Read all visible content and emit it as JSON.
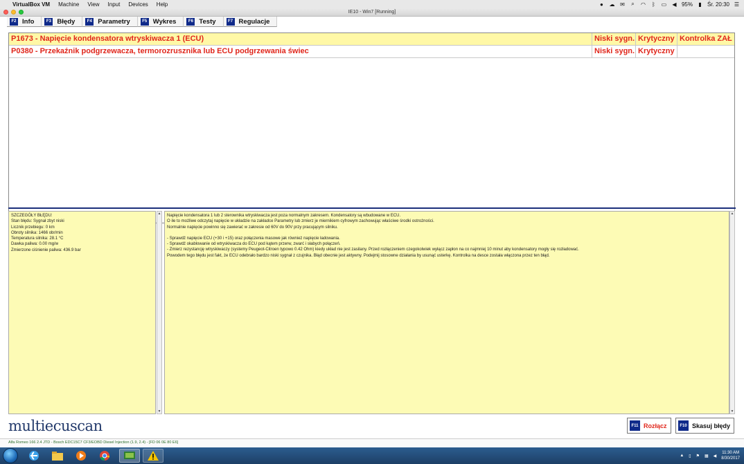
{
  "mac_menubar": {
    "app": "VirtualBox VM",
    "menus": [
      "Machine",
      "View",
      "Input",
      "Devices",
      "Help"
    ],
    "battery": "95%",
    "clock": "Śr. 20:30"
  },
  "window": {
    "title": "IE10 - Win7 [Running]"
  },
  "tabs": [
    {
      "key": "F2",
      "label": "Info"
    },
    {
      "key": "F3",
      "label": "Błędy"
    },
    {
      "key": "F4",
      "label": "Parametry"
    },
    {
      "key": "F5",
      "label": "Wykres"
    },
    {
      "key": "F6",
      "label": "Testy"
    },
    {
      "key": "F7",
      "label": "Regulacje"
    }
  ],
  "errors": [
    {
      "code_desc": "P1673 - Napięcie kondensatora wtryskiwacza 1 (ECU)",
      "signal": "Niski sygn.",
      "severity": "Krytyczny",
      "lamp": "Kontrolka ZAŁ"
    },
    {
      "code_desc": "P0380 - Przekaźnik podgrzewacza, termorozrusznika lub ECU podgrzewania świec",
      "signal": "Niski sygn.",
      "severity": "Krytyczny",
      "lamp": ""
    }
  ],
  "details": {
    "header": "SZCZEGÓŁY BŁĘDU:",
    "lines": [
      "Stan błędu: Sygnał zbyt niski",
      "Licznik przebiegu: 0 km",
      "Obroty silnika: 1466 obr/min",
      "Temperatura silnika: 28.1 °C",
      "Dawka paliwa: 0.00 mg/w",
      "Zmierzone ciśnienie paliwa: 436.9 bar"
    ]
  },
  "description": {
    "lines": [
      "Napięcie kondensatora 1 lub 2 sterownika wtryskiwacza jest poza normalnym zakresem. Kondensatory są wbudowane w ECU.",
      "O ile to możliwe odczytaj napięcie w układzie na zakładce Parametry lub zmierz je miernikiem cyfrowym zachowując właściwe środki ostrożności.",
      "Normalnie napięcie powinno się zawierać w zakresie od 60V do 90V przy pracującym silniku.",
      "",
      "- Sprawdź napięcie ECU (+30 i +15) oraz połączenia masowe jak również napięcie ładowania.",
      "- Sprawdź okablowanie od wtryskiwacza do ECU pod kątem przerw, zwarć i słabych połączeń.",
      "- Zmierz rezystancję wtryskiwaczy (systemy Peugeot-Citroen typowo 0.42 Ohm) kiedy układ nie jest zasilany. Przed rozłączeniem czegokolwiek wyłącz zapłon na co najmniej 10 minut aby kondensatory mogły się rozładować.",
      "Powodem tego błędu jest fakt, że ECU odebrało bardzo niski sygnał z czujnika. Błąd obecnie jest aktywny. Podejmij stosowne działania by usunąć usterkę. Kontrolka na desce została włączona przez ten błąd."
    ]
  },
  "logo": "multiecuscan",
  "buttons": {
    "disconnect": {
      "key": "F11",
      "label": "Rozłącz"
    },
    "clear": {
      "key": "F10",
      "label": "Skasuj błędy"
    }
  },
  "status_bar": "Alfa Romeo 166 2.4 JTD - Bosch EDC15C7 CF3/EOBD Diesel Injection (1.9, 2.4) - [FD 06 0E 80 E6]",
  "taskbar": {
    "time": "11:30 AM",
    "date": "8/30/2017"
  },
  "colors": {
    "error_red": "#e0261b",
    "selected_row": "#fff8a6",
    "panel_yellow": "#fdfbb5",
    "fkey_blue": "#0f2a8a",
    "logo_blue": "#233a6b"
  }
}
